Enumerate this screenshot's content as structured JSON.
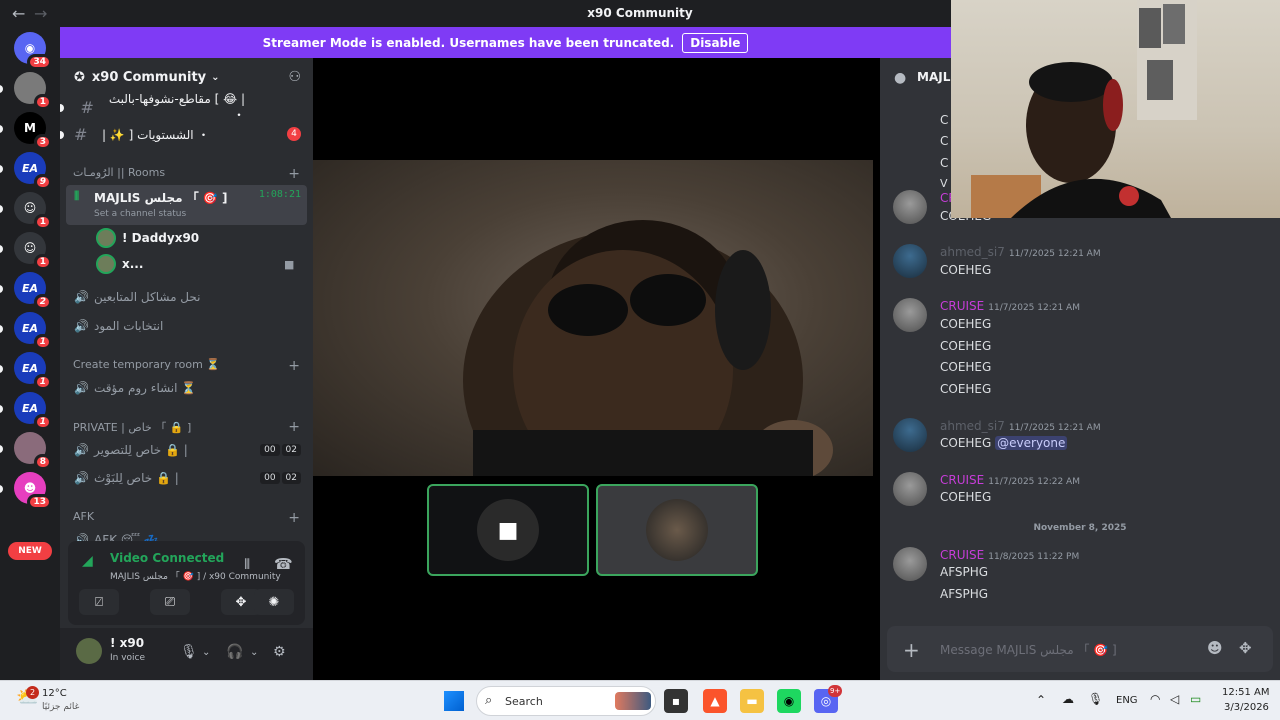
{
  "window": {
    "title": "x90 Community",
    "back_icon": "←",
    "forward_icon": "→"
  },
  "banner": {
    "text": "Streamer Mode is enabled. Usernames have been truncated.",
    "button": "Disable"
  },
  "rail": {
    "home_badge": "34",
    "badges": [
      "1",
      "3",
      "9",
      "1",
      "1",
      "2",
      "1",
      "1",
      "1",
      "8",
      "13"
    ],
    "new_label": "NEW",
    "ea_label": "EA",
    "m_label": "M"
  },
  "guild": {
    "name": "x90 Community",
    "channels_top": [
      {
        "name": "| 😂 ] مقاطع-نشوفها-بالبث ・"
      },
      {
        "name": "| ✨ ] الشستويات ・",
        "badge": "4"
      }
    ],
    "cat_rooms": "الرُومـات || Rooms",
    "active_voice": {
      "name": "MAJLIS مجلس 「 🎯 ]",
      "timer": "1:08:21",
      "status": "Set a channel status"
    },
    "vc_users": [
      "! Daddyx90",
      "x..."
    ],
    "voice_channels": [
      "نحل مشاكل المتابعين",
      "انتخابات المود"
    ],
    "cat_temp": "Create temporary room ⏳",
    "temp_channel": "انشاء روم مؤقت ⏳",
    "cat_private": "PRIVATE | خاص 「 🔒 ]",
    "private_channels": [
      {
        "name": "خاص لِلتصوير 🔒 |",
        "a": "00",
        "b": "02"
      },
      {
        "name": "خاص لِلبَوْث 🔒 |",
        "a": "00",
        "b": "02"
      }
    ],
    "cat_afk": "AFK",
    "afk_channel": "AFK 😴 💤"
  },
  "voice_panel": {
    "status": "Video Connected",
    "channel": "MAJLIS مجلس 「 🎯 ]  / x90 Community"
  },
  "user_panel": {
    "name": "! x90",
    "status": "In voice"
  },
  "chat": {
    "header": "MAJLIS",
    "top_fragments": [
      "C",
      "C",
      "C",
      "V"
    ],
    "messages": [
      {
        "author": "CRUISE",
        "time": "",
        "lines": [
          "COEHEG"
        ]
      },
      {
        "author": "ahmed_si7",
        "time": "11/7/2025 12:21 AM",
        "lines": [
          "COEHEG"
        ]
      },
      {
        "author": "CRUISE",
        "time": "11/7/2025 12:21 AM",
        "lines": [
          "COEHEG",
          "COEHEG",
          "COEHEG",
          "COEHEG"
        ]
      },
      {
        "author": "ahmed_si7",
        "time": "11/7/2025 12:21 AM",
        "lines": [
          "COEHEG"
        ],
        "mention": "@everyone"
      },
      {
        "author": "CRUISE",
        "time": "11/7/2025 12:22 AM",
        "lines": [
          "COEHEG"
        ]
      },
      {
        "author": "CRUISE",
        "time": "11/8/2025 11:22 PM",
        "lines": [
          "AFSPHG",
          "AFSPHG"
        ]
      }
    ],
    "date_divider": "November 8, 2025",
    "input_placeholder": "Message MAJLIS مجلس 「 🎯 ]"
  },
  "taskbar": {
    "weather_temp": "12°C",
    "weather_desc": "غائم جزئيًا",
    "weather_badge": "2",
    "search": "Search",
    "lang": "ENG",
    "time": "12:51 AM",
    "date": "3/3/2026",
    "discord_badge": "9+"
  },
  "colors": {
    "accent": "#7f3bf5",
    "online": "#23a55a",
    "cruise": "#c63dd8",
    "danger": "#f23f43"
  }
}
